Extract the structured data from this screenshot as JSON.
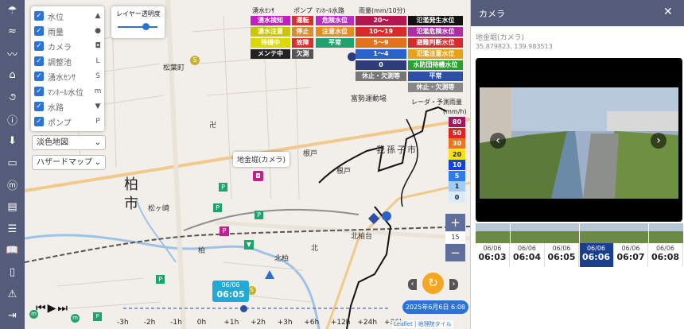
{
  "layers": [
    {
      "label": "水位",
      "symbol": "▲"
    },
    {
      "label": "雨量",
      "symbol": "●"
    },
    {
      "label": "カメラ",
      "symbol": "◘"
    },
    {
      "label": "調整池",
      "symbol": "L"
    },
    {
      "label": "湧水ｾﾝｻ",
      "symbol": "S"
    },
    {
      "label": "ﾏﾝﾎｰﾙ水位",
      "symbol": "m"
    },
    {
      "label": "水路",
      "symbol": "▼"
    },
    {
      "label": "ポンプ",
      "symbol": "P"
    }
  ],
  "checkmark": "✓",
  "basemap_select": "淡色地図",
  "hazard_select": "ハザードマップ",
  "chevron": "⌄",
  "opacity_label": "レイヤー透明度",
  "opacity_value": 0.7,
  "legend": {
    "headers": {
      "spring": "湧水ｾﾝｻ",
      "pump": "ポンプ",
      "manhole": "ﾏﾝﾎｰﾙ水路",
      "rain": "雨量(mm/10分)"
    },
    "spring": [
      {
        "label": "湧水検知",
        "color": "#c21fc0"
      },
      {
        "label": "湧水注意",
        "color": "#c8c700"
      },
      {
        "label": "待機中",
        "color": "#d9d900"
      },
      {
        "label": "メンテ中",
        "color": "#222222"
      }
    ],
    "pump": [
      {
        "label": "運転",
        "color": "#d63030"
      },
      {
        "label": "停止",
        "color": "#e08a2a"
      },
      {
        "label": "故障",
        "color": "#d63030"
      },
      {
        "label": "欠測",
        "color": "#555555"
      }
    ],
    "manhole": [
      {
        "label": "危険水位",
        "color": "#b52fc1"
      },
      {
        "label": "注意水位",
        "color": "#e88b1f"
      },
      {
        "label": "平常",
        "color": "#1fa36e"
      }
    ],
    "rain": [
      {
        "label": "20～",
        "color": "#b3174d"
      },
      {
        "label": "10～19",
        "color": "#d92b2b"
      },
      {
        "label": "5～9",
        "color": "#e5711c"
      },
      {
        "label": "1～4",
        "color": "#2962c8"
      },
      {
        "label": "0",
        "color": "#2e3d7a"
      },
      {
        "label": "休止・欠測等",
        "color": "#777777"
      }
    ],
    "river": [
      {
        "label": "氾濫発生水位",
        "color": "#111111"
      },
      {
        "label": "氾濫危険水位",
        "color": "#b12aa8"
      },
      {
        "label": "避難判断水位",
        "color": "#d92b2b"
      },
      {
        "label": "氾濫注意水位",
        "color": "#e8a21a"
      },
      {
        "label": "水防団待機水位",
        "color": "#27a02f"
      },
      {
        "label": "平常",
        "color": "#2d4fa8"
      },
      {
        "label": "休止・欠測等",
        "color": "#888888"
      }
    ]
  },
  "radar": {
    "title": "レーダ・予測雨量",
    "unit": "(mm/h)",
    "scale": [
      "80",
      "50",
      "30",
      "20",
      "10",
      "5",
      "1",
      "0"
    ],
    "colors": [
      "#a8145f",
      "#e02424",
      "#e8761c",
      "#f5e21b",
      "#1a40d8",
      "#2f7bea",
      "#a0cdf8",
      "#d8ecfc"
    ]
  },
  "zoom": {
    "plus": "+",
    "level": "15",
    "minus": "−"
  },
  "map_labels": {
    "area1": "松葉町",
    "area2": "我孫子市",
    "area3": "根戸",
    "area4": "北柏",
    "area5": "北柏台",
    "area6": "松ヶ崎",
    "area7": "富勢運動場",
    "area8": "柏",
    "area9": "市",
    "area10": "柏",
    "area11": "北",
    "area12": "卍",
    "area13": "根戸"
  },
  "tooltip": "地金堀(カメラ)",
  "timeline": {
    "date": "06/06",
    "time": "06:05",
    "date_stamp": "2025年6月6日 6:08",
    "ticks": [
      "-3h",
      "-2h",
      "-1h",
      "0h",
      "+1h",
      "+2h",
      "+3h",
      "+6h",
      "+12h",
      "+24h",
      "+36h"
    ],
    "track_fraction": 0.45
  },
  "attribution": "Leaflet | 地理院タイル",
  "panel": {
    "title": "カメラ",
    "close": "✕",
    "station": "地金堀(カメラ)",
    "coords": "35.879823, 139.983513",
    "nav_prev": "‹",
    "nav_next": "›",
    "times": [
      {
        "date": "06/06",
        "time": "06:03"
      },
      {
        "date": "06/06",
        "time": "06:04"
      },
      {
        "date": "06/06",
        "time": "06:05"
      },
      {
        "date": "06/06",
        "time": "06:06",
        "active": true
      },
      {
        "date": "06/06",
        "time": "06:07"
      },
      {
        "date": "06/06",
        "time": "06:08"
      }
    ]
  }
}
